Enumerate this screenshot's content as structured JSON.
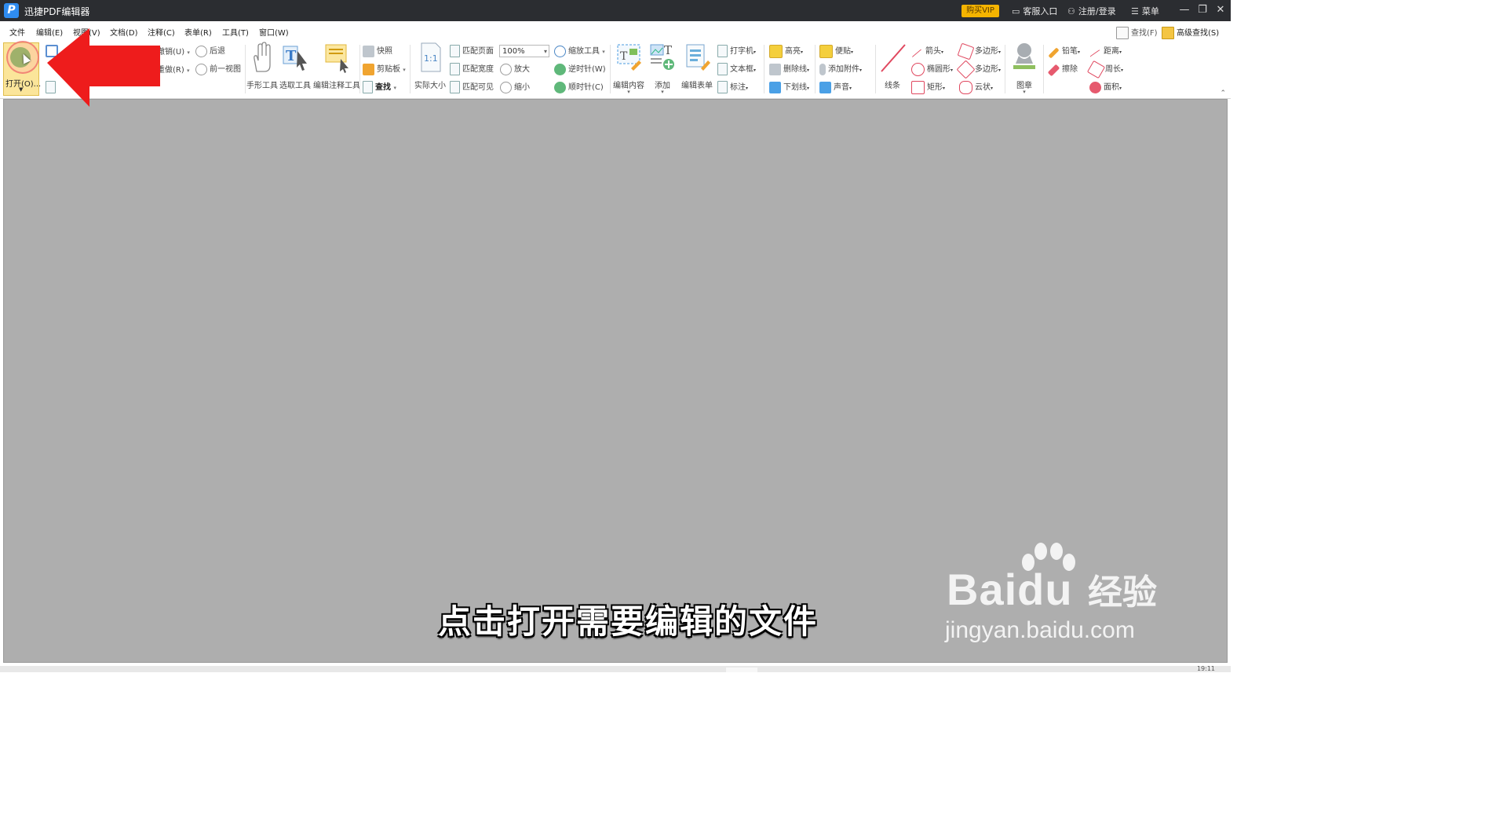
{
  "titlebar": {
    "title": "迅捷PDF编辑器",
    "logo_letter": "P",
    "vip": "购买VIP",
    "service": "客服入口",
    "login": "注册/登录",
    "menu": "菜单",
    "icons": [
      "chat-icon",
      "user-icon",
      "hamburger-icon",
      "minimize-icon",
      "restore-icon",
      "close-icon"
    ]
  },
  "menubar": {
    "items": [
      "文件",
      "编辑(E)",
      "视图(V)",
      "文档(D)",
      "注释(C)",
      "表单(R)",
      "工具(T)",
      "窗口(W)"
    ],
    "find": "查找(F)",
    "advanced_find": "高级查找(S)"
  },
  "ribbon": {
    "open": "打开(O)...",
    "undo": "撤销(U)",
    "redo": "重做(R)",
    "back": "后退",
    "prev_view": "前一视图",
    "hand_tool": "手形工具",
    "select_tool": "选取工具",
    "edit_annot_tool": "编辑注释工具",
    "snapshot": "快照",
    "clipboard": "剪贴板",
    "find": "查找",
    "actual_size": "实际大小",
    "actual_size_icon_text": "1:1",
    "fit_page": "匹配页面",
    "fit_width": "匹配宽度",
    "fit_visible": "匹配可见",
    "zoom_value": "100%",
    "zoom_tool": "缩放工具",
    "zoom_in": "放大",
    "zoom_out": "缩小",
    "rotate_ccw": "逆时针(W)",
    "rotate_cw": "顺时针(C)",
    "edit_content": "编辑内容",
    "add": "添加",
    "edit_form": "编辑表单",
    "typewriter": "打字机",
    "textbox": "文本框",
    "callout": "标注",
    "highlight": "高亮",
    "strikeout": "删除线",
    "underline": "下划线",
    "note": "便贴",
    "attach": "添加附件",
    "sound": "声音",
    "line": "线条",
    "arrow": "箭头",
    "ellipse": "椭圆形",
    "rect": "矩形",
    "polygon1": "多边形",
    "polygon2": "多边形",
    "cloud": "云状",
    "stamp": "图章",
    "pencil": "铅笔",
    "eraser": "擦除",
    "distance": "距离",
    "perimeter": "周长",
    "area": "面积"
  },
  "overlay": {
    "subtitle": "点击打开需要编辑的文件",
    "watermark_brand": "Baidu",
    "watermark_jy": "经验",
    "watermark_url": "jingyan.baidu.com"
  },
  "statusbar": {
    "time": "19:11"
  },
  "colors": {
    "titlebar_bg": "#2b2d31",
    "vip_bg": "#f5b400",
    "workspace_bg": "#aeaeae",
    "arrow_red": "#ee1c1c",
    "open_highlight": "#fbe59a"
  }
}
